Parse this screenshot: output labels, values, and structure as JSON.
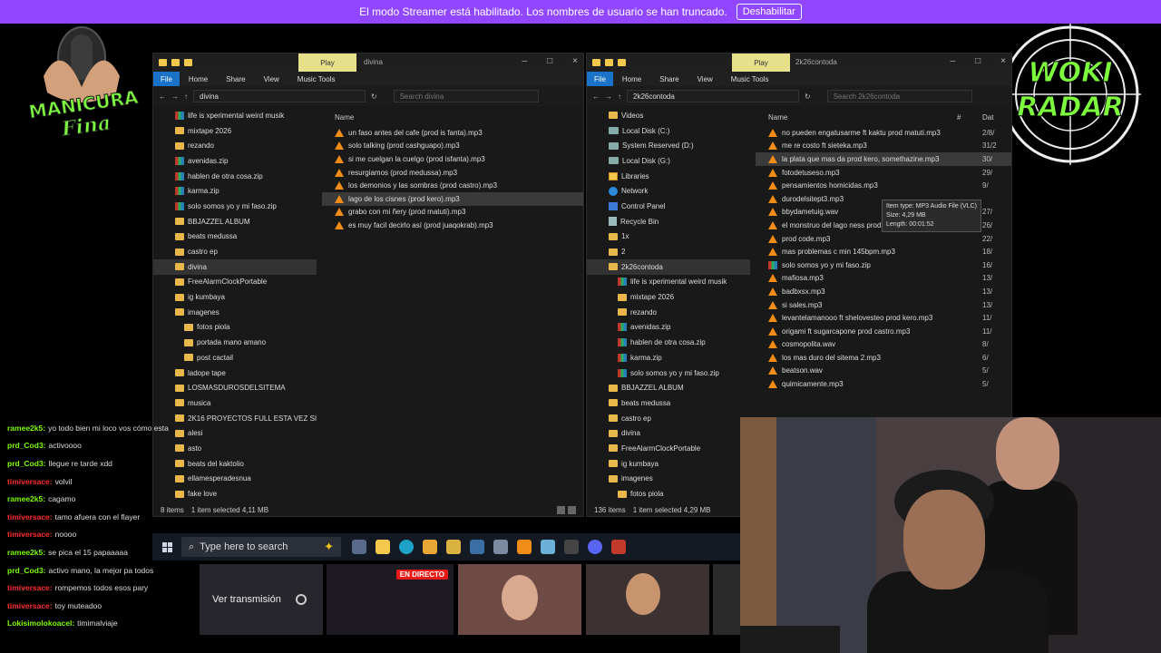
{
  "banner": {
    "text": "El modo Streamer está habilitado. Los nombres de usuario se han truncado.",
    "button": "Deshabilitar"
  },
  "logos": {
    "left": "MANICURA Fina",
    "right": "WOKI RADAR"
  },
  "left_window": {
    "play_tab": "Play",
    "title": "divina",
    "ribbon": [
      "File",
      "Home",
      "Share",
      "View",
      "Music Tools"
    ],
    "path": "divina",
    "search_placeholder": "Search divina",
    "col_name": "Name",
    "nav": [
      {
        "label": "life is xperimental weird musik",
        "icon": "zip"
      },
      {
        "label": "mixtape 2026",
        "icon": "folder"
      },
      {
        "label": "rezando",
        "icon": "folder"
      },
      {
        "label": "avenidas.zip",
        "icon": "zip"
      },
      {
        "label": "hablen de otra cosa.zip",
        "icon": "zip"
      },
      {
        "label": "karma.zip",
        "icon": "zip"
      },
      {
        "label": "solo somos yo y mi faso.zip",
        "icon": "zip"
      },
      {
        "label": "BBJAZZEL ALBUM",
        "icon": "folder"
      },
      {
        "label": "beats medussa",
        "icon": "folder"
      },
      {
        "label": "castro ep",
        "icon": "folder"
      },
      {
        "label": "divina",
        "icon": "folder",
        "selected": true
      },
      {
        "label": "FreeAlarmClockPortable",
        "icon": "folder"
      },
      {
        "label": "ig kumbaya",
        "icon": "folder"
      },
      {
        "label": "imagenes",
        "icon": "folder"
      },
      {
        "label": "fotos piola",
        "icon": "folder",
        "indent": true
      },
      {
        "label": "portada mano amano",
        "icon": "folder",
        "indent": true
      },
      {
        "label": "post cactail",
        "icon": "folder",
        "indent": true
      },
      {
        "label": "ladope tape",
        "icon": "folder"
      },
      {
        "label": "LOSMASDUROSDELSITEMA",
        "icon": "folder"
      },
      {
        "label": "musica",
        "icon": "folder"
      },
      {
        "label": "2K16 PROYECTOS FULL ESTA VEZ SI",
        "icon": "folder"
      },
      {
        "label": "alesi",
        "icon": "folder"
      },
      {
        "label": "asto",
        "icon": "folder"
      },
      {
        "label": "beats del kaktolio",
        "icon": "folder"
      },
      {
        "label": "ellamesperadesnua",
        "icon": "folder"
      },
      {
        "label": "fake love",
        "icon": "folder"
      }
    ],
    "files": [
      {
        "name": "un faso antes del cafe (prod is fanta).mp3"
      },
      {
        "name": "solo talking (prod cashguapo).mp3"
      },
      {
        "name": "si me cuelgan la cuelgo (prod isfanta).mp3"
      },
      {
        "name": "resurgiamos (prod medussa).mp3"
      },
      {
        "name": "los demonios y las sombras (prod castro).mp3"
      },
      {
        "name": "lago de los cisnes (prod kero).mp3",
        "selected": true
      },
      {
        "name": "grabo con mi ñery (prod matuti).mp3"
      },
      {
        "name": "es muy facil decirlo así (prod juaqokrab).mp3"
      }
    ],
    "status_items": "8 items",
    "status_selected": "1 item selected  4,11 MB"
  },
  "right_window": {
    "play_tab": "Play",
    "title": "2k26contoda",
    "ribbon": [
      "File",
      "Home",
      "Share",
      "View",
      "Music Tools"
    ],
    "path": "2k26contoda",
    "search_placeholder": "Search 2k26contoda",
    "col_name": "Name",
    "col_num": "#",
    "col_date": "Dat",
    "nav": [
      {
        "label": "Videos",
        "icon": "folder"
      },
      {
        "label": "Local Disk (C:)",
        "icon": "drive"
      },
      {
        "label": "System Reserved (D:)",
        "icon": "drive"
      },
      {
        "label": "Local Disk (G:)",
        "icon": "drive"
      },
      {
        "label": "Libraries",
        "icon": "lib"
      },
      {
        "label": "Network",
        "icon": "net"
      },
      {
        "label": "Control Panel",
        "icon": "cp"
      },
      {
        "label": "Recycle Bin",
        "icon": "bin"
      },
      {
        "label": "1x",
        "icon": "folder"
      },
      {
        "label": "2",
        "icon": "folder"
      },
      {
        "label": "2k26contoda",
        "icon": "folder",
        "selected": true
      },
      {
        "label": "life is xperimental weird musik",
        "icon": "zip",
        "indent": true
      },
      {
        "label": "mixtape 2026",
        "icon": "folder",
        "indent": true
      },
      {
        "label": "rezando",
        "icon": "folder",
        "indent": true
      },
      {
        "label": "avenidas.zip",
        "icon": "zip",
        "indent": true
      },
      {
        "label": "hablen de otra cosa.zip",
        "icon": "zip",
        "indent": true
      },
      {
        "label": "karma.zip",
        "icon": "zip",
        "indent": true
      },
      {
        "label": "solo somos yo y mi faso.zip",
        "icon": "zip",
        "indent": true
      },
      {
        "label": "BBJAZZEL ALBUM",
        "icon": "folder"
      },
      {
        "label": "beats medussa",
        "icon": "folder"
      },
      {
        "label": "castro ep",
        "icon": "folder"
      },
      {
        "label": "divina",
        "icon": "folder"
      },
      {
        "label": "FreeAlarmClockPortable",
        "icon": "folder"
      },
      {
        "label": "ig kumbaya",
        "icon": "folder"
      },
      {
        "label": "imagenes",
        "icon": "folder"
      },
      {
        "label": "fotos piola",
        "icon": "folder",
        "indent": true
      }
    ],
    "files": [
      {
        "name": "no pueden engatusarme ft kaktu prod matuti.mp3",
        "date": "2/8/",
        "icon": "vlc"
      },
      {
        "name": "me re costo ft sieteka.mp3",
        "date": "31/2",
        "icon": "vlc"
      },
      {
        "name": "la plata que mas da prod kero, somethazine.mp3",
        "date": "30/",
        "icon": "vlc",
        "selected": true
      },
      {
        "name": "fotodetuseso.mp3",
        "date": "29/",
        "icon": "vlc"
      },
      {
        "name": "pensamientos homicidas.mp3",
        "date": "9/",
        "icon": "vlc"
      },
      {
        "name": "durodelsitept3.mp3",
        "date": "",
        "icon": "vlc"
      },
      {
        "name": "bbydametuig.wav",
        "date": "27/",
        "icon": "vlc"
      },
      {
        "name": "el monstruo del lago ness prod 0juakkim.wav",
        "date": "26/",
        "icon": "vlc"
      },
      {
        "name": "prod code.mp3",
        "date": "22/",
        "icon": "vlc"
      },
      {
        "name": "mas problemas c min 145bpm.mp3",
        "date": "18/",
        "icon": "vlc"
      },
      {
        "name": "solo somos yo y mi faso.zip",
        "date": "16/",
        "icon": "zip"
      },
      {
        "name": "mafiosa.mp3",
        "date": "13/",
        "icon": "vlc"
      },
      {
        "name": "badbxsx.mp3",
        "date": "13/",
        "icon": "vlc"
      },
      {
        "name": "si sales.mp3",
        "date": "13/",
        "icon": "vlc"
      },
      {
        "name": "levantelamanooo ft shelovesteo prod kero.mp3",
        "date": "11/",
        "icon": "vlc"
      },
      {
        "name": "origami ft sugarcapone prod castro.mp3",
        "date": "11/",
        "icon": "vlc"
      },
      {
        "name": "cosmopolita.wav",
        "date": "8/",
        "icon": "vlc"
      },
      {
        "name": "los mas duro del sitema 2.mp3",
        "date": "6/",
        "icon": "vlc"
      },
      {
        "name": "beatson.wav",
        "date": "5/",
        "icon": "vlc"
      },
      {
        "name": "quimicamente.mp3",
        "date": "5/",
        "icon": "vlc"
      }
    ],
    "tooltip": [
      "Item type: MP3 Audio File (VLC)",
      "Size: 4,29 MB",
      "Length: 00:01:52"
    ],
    "status_items": "136 items",
    "status_selected": "1 item selected  4,29 MB"
  },
  "taskbar": {
    "search_placeholder": "Type here to search"
  },
  "chat": [
    {
      "user": "ramee2k5:",
      "msg": "yo todo bien mi loco vos cómo esta",
      "color": "#7cfc00"
    },
    {
      "user": "prd_Cod3:",
      "msg": "activoooo",
      "color": "#7cfc00"
    },
    {
      "user": "prd_Cod3:",
      "msg": "llegue re tarde xdd",
      "color": "#7cfc00"
    },
    {
      "user": "timiversace:",
      "msg": "volvil",
      "color": "#ff2d2d"
    },
    {
      "user": "ramee2k5:",
      "msg": "cagamo",
      "color": "#7cfc00"
    },
    {
      "user": "timiversace:",
      "msg": "tamo afuera con el flayer",
      "color": "#ff2d2d"
    },
    {
      "user": "timiversace:",
      "msg": "noooo",
      "color": "#ff2d2d"
    },
    {
      "user": "ramee2k5:",
      "msg": "se pica el 15 papaaaaa",
      "color": "#7cfc00"
    },
    {
      "user": "prd_Cod3:",
      "msg": "activo mano, la mejor pa todos",
      "color": "#7cfc00"
    },
    {
      "user": "timiversace:",
      "msg": "rompemos todos esos pary",
      "color": "#ff2d2d"
    },
    {
      "user": "timiversace:",
      "msg": "toy muteadoo",
      "color": "#ff2d2d"
    },
    {
      "user": "Lokisimolokoacel:",
      "msg": "timimalviaje",
      "color": "#7cfc00"
    }
  ],
  "strip": {
    "ver_transmision": "Ver transmisión",
    "live_badge": "EN DIRECTO"
  }
}
